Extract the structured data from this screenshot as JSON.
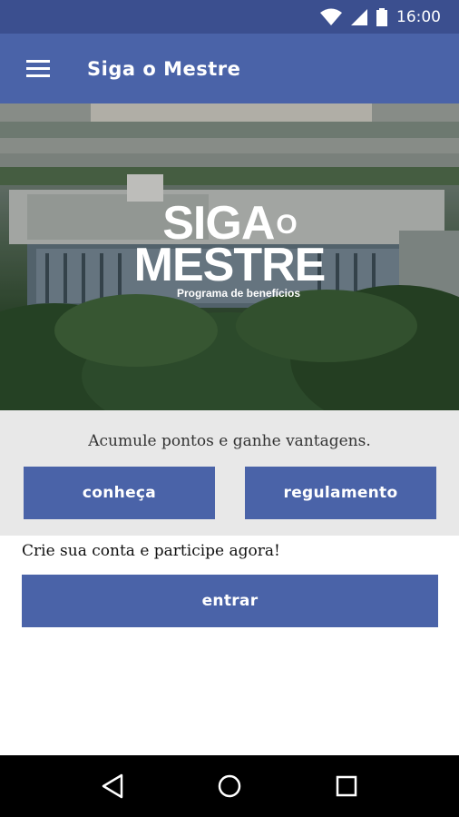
{
  "status_bar": {
    "time": "16:00"
  },
  "app_bar": {
    "title": "Siga o Mestre",
    "menu_icon": "hamburger-menu-icon"
  },
  "hero": {
    "logo_line1": "SIGA",
    "logo_line1_small": "O",
    "logo_line2": "MESTRE",
    "logo_tagline": "Programa de benefícios"
  },
  "promo": {
    "text": "Acumule pontos e ganhe vantagens.",
    "button_conheca": "conheça",
    "button_regulamento": "regulamento"
  },
  "cta": {
    "text": "Crie sua conta e participe agora!",
    "button_entrar": "entrar"
  },
  "colors": {
    "primary": "#4a63a8",
    "status_bar": "#3b4f8f",
    "promo_background": "#e8e8e8"
  },
  "nav_bar": {
    "icons": [
      "back-icon",
      "home-icon",
      "recents-icon"
    ]
  }
}
